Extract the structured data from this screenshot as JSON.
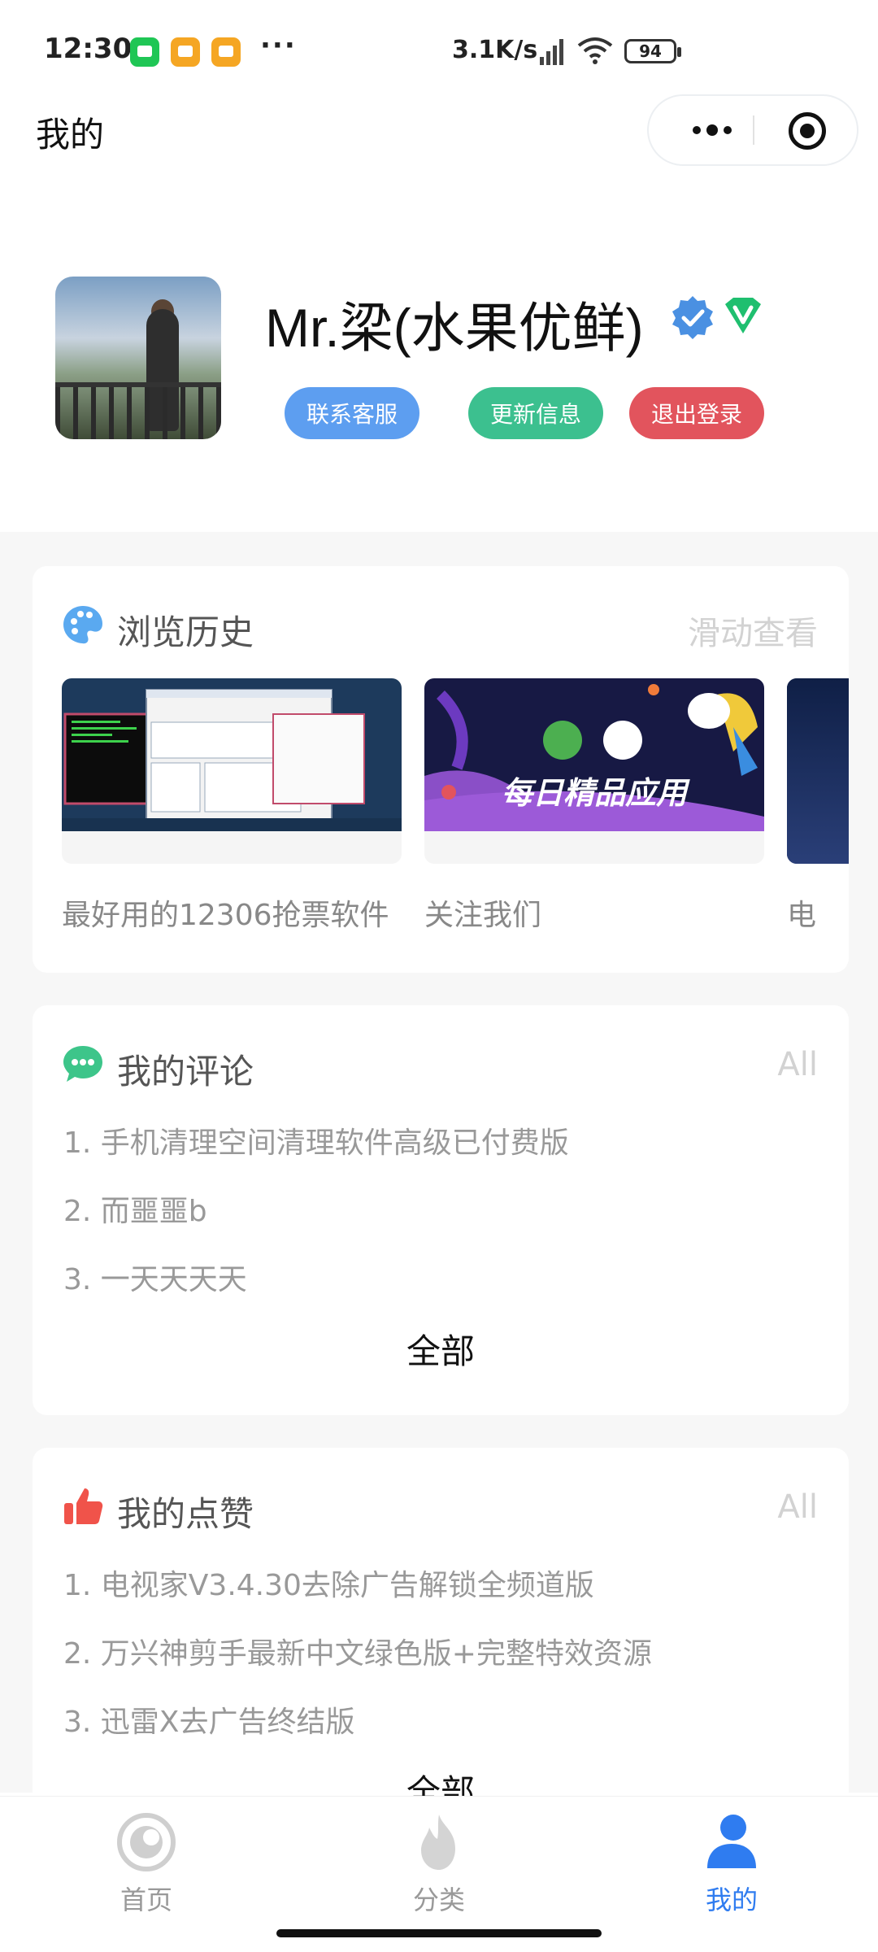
{
  "status_bar": {
    "time": "12:30",
    "more": "···",
    "network_speed": "3.1K/s",
    "battery": "94"
  },
  "nav": {
    "title": "我的"
  },
  "profile": {
    "name": "Mr.梁(水果优鲜)",
    "buttons": {
      "service": "联系客服",
      "update": "更新信息",
      "logout": "退出登录"
    }
  },
  "history": {
    "title": "浏览历史",
    "more": "滑动查看",
    "items": [
      {
        "label": "最好用的12306抢票软件"
      },
      {
        "label": "关注我们",
        "banner_text": "每日精品应用"
      },
      {
        "label": "电"
      }
    ]
  },
  "comments": {
    "title": "我的评论",
    "more": "All",
    "items": [
      "1. 手机清理空间清理软件高级已付费版",
      "2. 而噩噩b",
      "3. 一天天天天"
    ],
    "all_label": "全部"
  },
  "likes": {
    "title": "我的点赞",
    "more": "All",
    "items": [
      "1. 电视家V3.4.30去除广告解锁全频道版",
      "2. 万兴神剪手最新中文绿色版+完整特效资源",
      "3. 迅雷X去广告终结版"
    ],
    "all_label": "全部"
  },
  "tab_bar": {
    "tabs": [
      {
        "label": "首页",
        "icon": "home-icon"
      },
      {
        "label": "分类",
        "icon": "flame-icon"
      },
      {
        "label": "我的",
        "icon": "user-icon"
      }
    ],
    "active_color": "#2f7cf0"
  }
}
